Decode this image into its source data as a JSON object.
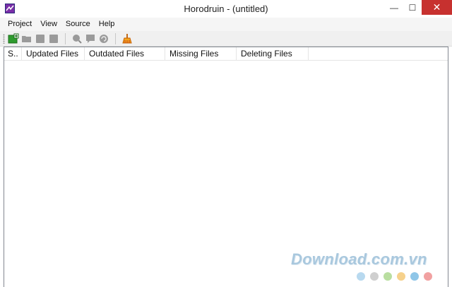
{
  "window": {
    "title": "Horodruin - (untitled)",
    "min_glyph": "—",
    "max_glyph": "☐",
    "close_glyph": "✕"
  },
  "menu": {
    "items": [
      "Project",
      "View",
      "Source",
      "Help"
    ]
  },
  "toolbar": {
    "icons": [
      "add-icon",
      "open-folder-icon",
      "save-icon",
      "save-all-icon",
      "search-icon",
      "comment-icon",
      "refresh-icon",
      "clean-icon"
    ]
  },
  "list": {
    "columns": [
      "S..",
      "Updated Files",
      "Outdated Files",
      "Missing Files",
      "Deleting Files"
    ]
  },
  "watermark": {
    "text": "Download.com.vn",
    "dot_colors": [
      "#b8d9ef",
      "#cfcfcf",
      "#b9dea0",
      "#f6d18c",
      "#8fc6e8",
      "#f1a1a1"
    ]
  },
  "colors": {
    "close_button": "#c7312f",
    "toolbar_icon_gray": "#9a9a9a",
    "add_icon_green": "#2e9b2e"
  }
}
